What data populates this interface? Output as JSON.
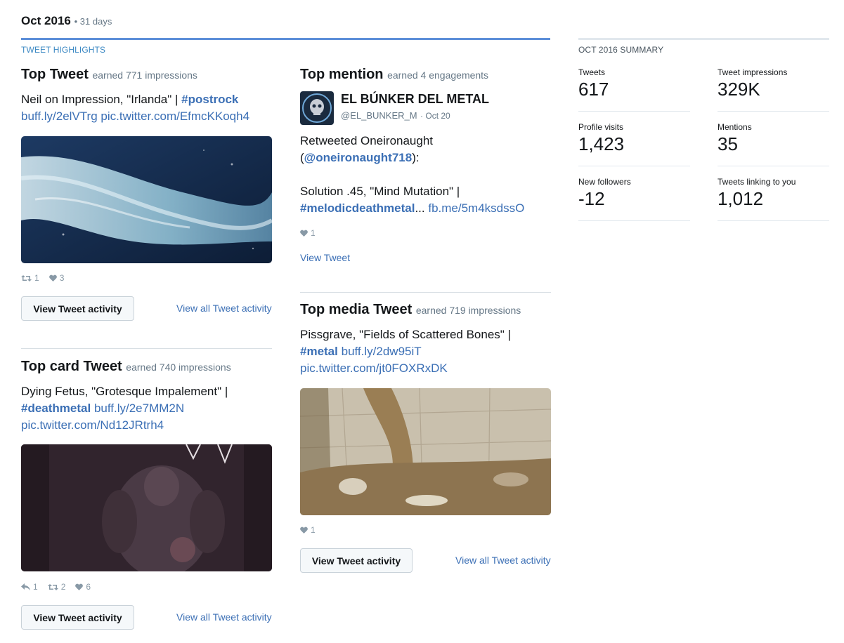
{
  "header": {
    "month": "Oct 2016",
    "days": "• 31 days"
  },
  "highlights": {
    "label": "TWEET HIGHLIGHTS",
    "top_tweet": {
      "title": "Top Tweet",
      "meta": "earned 771 impressions",
      "text_plain": "Neil on Impression, \"Irlanda\" | ",
      "hashtag": "#postrock",
      "link1": "buff.ly/2elVTrg",
      "link2": "pic.twitter.com/EfmcKKoqh4",
      "retweets": "1",
      "likes": "3",
      "button": "View Tweet activity",
      "view_all": "View all Tweet activity"
    },
    "top_card": {
      "title": "Top card Tweet",
      "meta": "earned 740 impressions",
      "text_plain": "Dying Fetus, \"Grotesque Impalement\" |",
      "hashtag": "#deathmetal",
      "link1": "buff.ly/2e7MM2N",
      "link2": "pic.twitter.com/Nd12JRtrh4",
      "replies": "1",
      "retweets": "2",
      "likes": "6",
      "button": "View Tweet activity",
      "view_all": "View all Tweet activity"
    },
    "top_mention": {
      "title": "Top mention",
      "meta": "earned 4 engagements",
      "account_name": "EL BÚNKER DEL METAL",
      "account_handle": "@EL_BUNKER_M",
      "date": "· Oct 20",
      "line1": "Retweeted Oneironaught",
      "mention_open": "(",
      "mention": "@oneironaught718",
      "mention_close": "):",
      "line3": "Solution .45, \"Mind Mutation\" |",
      "hashtag": "#melodicdeathmetal",
      "ellipsis": "...",
      "link1": "fb.me/5m4ksdssO",
      "likes": "1",
      "view_tweet": "View Tweet"
    },
    "top_media": {
      "title": "Top media Tweet",
      "meta": "earned 719 impressions",
      "text_plain": "Pissgrave, \"Fields of Scattered Bones\" |",
      "hashtag": "#metal",
      "link1": "buff.ly/2dw95iT",
      "link2": "pic.twitter.com/jt0FOXRxDK",
      "likes": "1",
      "button": "View Tweet activity",
      "view_all": "View all Tweet activity"
    }
  },
  "summary": {
    "label": "OCT 2016 SUMMARY",
    "items": [
      {
        "label": "Tweets",
        "value": "617"
      },
      {
        "label": "Tweet impressions",
        "value": "329K"
      },
      {
        "label": "Profile visits",
        "value": "1,423"
      },
      {
        "label": "Mentions",
        "value": "35"
      },
      {
        "label": "New followers",
        "value": "-12"
      },
      {
        "label": "Tweets linking to you",
        "value": "1,012"
      }
    ]
  },
  "icons": {
    "retweet": "retweet-icon",
    "like": "heart-icon",
    "reply": "reply-icon"
  },
  "colors": {
    "accent": "#3b6fb5",
    "highlight_rule": "#5d8fd9",
    "muted": "#657786"
  }
}
